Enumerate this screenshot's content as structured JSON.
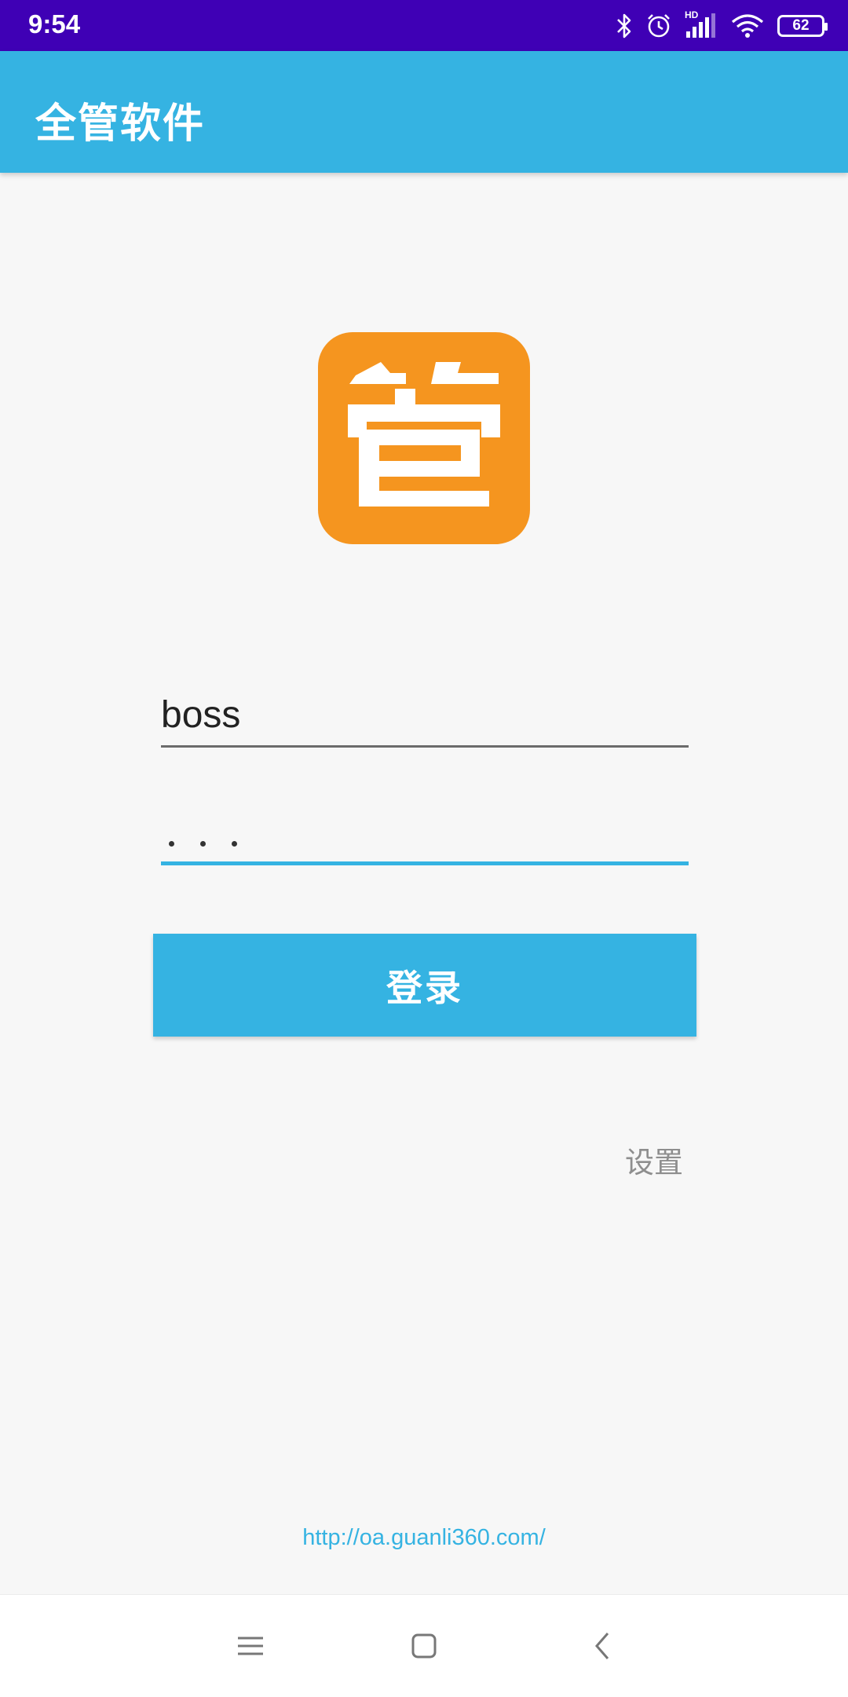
{
  "status_bar": {
    "time": "9:54",
    "network_label": "HD",
    "battery_level": "62",
    "icons": [
      "bluetooth-icon",
      "alarm-icon",
      "cellular-signal-icon",
      "wifi-icon",
      "battery-icon"
    ]
  },
  "app_bar": {
    "title": "全管软件"
  },
  "logo": {
    "glyph": "管",
    "color": "#f5951f"
  },
  "login_form": {
    "username_value": "boss",
    "password_mask": "···",
    "login_button_label": "登录",
    "settings_link_label": "设置"
  },
  "footer": {
    "url": "http://oa.guanli360.com/"
  },
  "nav_bar": {
    "icons": [
      "menu-icon",
      "home-icon",
      "back-icon"
    ]
  },
  "colors": {
    "status_bar": "#3f00b5",
    "accent": "#35b3e2",
    "logo": "#f5951f",
    "background": "#f7f7f7"
  }
}
